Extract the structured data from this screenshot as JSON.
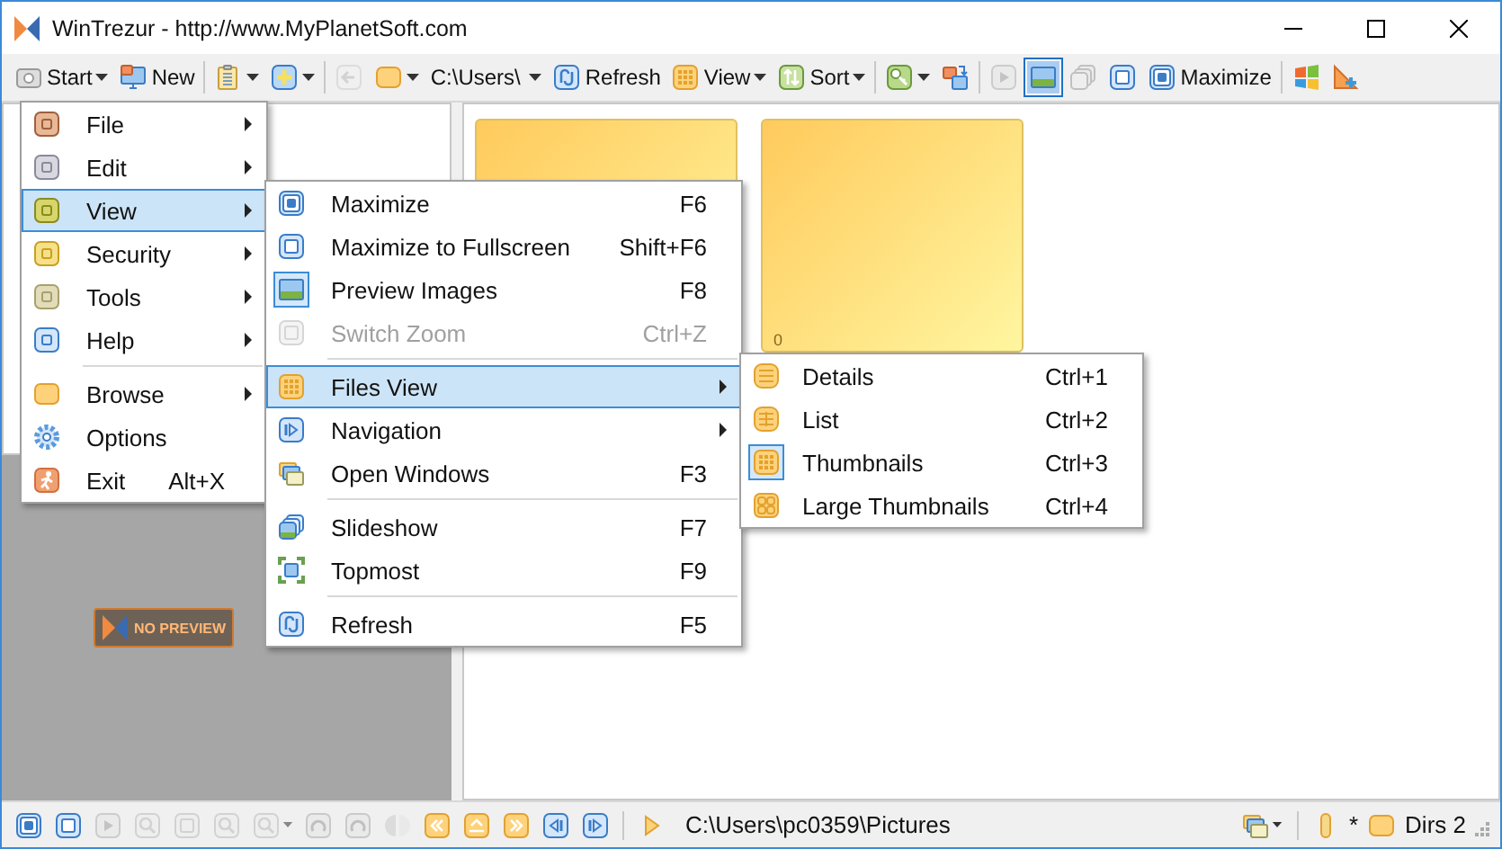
{
  "window": {
    "title": "WinTrezur - http://www.MyPlanetSoft.com"
  },
  "toolbar": [
    {
      "kind": "button",
      "label": "Start",
      "dropdown": true,
      "disabled": false
    },
    {
      "kind": "button",
      "label": "New",
      "dropdown": false,
      "disabled": false
    },
    {
      "kind": "separator"
    },
    {
      "kind": "button",
      "dropdown": true,
      "disabled": false
    },
    {
      "kind": "button",
      "dropdown": true,
      "disabled": false
    },
    {
      "kind": "separator"
    },
    {
      "kind": "button",
      "dropdown": false,
      "disabled": true
    },
    {
      "kind": "button",
      "dropdown": true,
      "disabled": false
    },
    {
      "kind": "path",
      "label": "C:\\Users\\",
      "dropdown": true
    },
    {
      "kind": "button",
      "label": "Refresh",
      "dropdown": false,
      "disabled": false
    },
    {
      "kind": "button",
      "label": "View",
      "dropdown": true,
      "disabled": false
    },
    {
      "kind": "button",
      "label": "Sort",
      "dropdown": true,
      "disabled": false
    },
    {
      "kind": "separator"
    },
    {
      "kind": "button",
      "dropdown": true,
      "disabled": false
    },
    {
      "kind": "button",
      "dropdown": false,
      "disabled": false
    },
    {
      "kind": "separator"
    },
    {
      "kind": "button",
      "dropdown": false,
      "disabled": true,
      "checked": false
    },
    {
      "kind": "button",
      "dropdown": false,
      "disabled": false,
      "checked": true
    },
    {
      "kind": "button",
      "dropdown": false,
      "disabled": true,
      "checked": false
    },
    {
      "kind": "button",
      "dropdown": false,
      "disabled": false
    },
    {
      "kind": "button",
      "label": "Maximize",
      "dropdown": false,
      "disabled": false
    },
    {
      "kind": "separator"
    },
    {
      "kind": "button",
      "dropdown": false,
      "disabled": false
    },
    {
      "kind": "button",
      "dropdown": false,
      "disabled": false
    }
  ],
  "preview": {
    "placeholder_text": "NO PREVIEW"
  },
  "thumbnails": [
    {
      "kind": "folder"
    },
    {
      "kind": "folder",
      "label": "0"
    }
  ],
  "menu": {
    "items": [
      {
        "label": "File",
        "selected": false,
        "submenu": true,
        "separator_above": false
      },
      {
        "label": "Edit",
        "selected": false,
        "submenu": true,
        "separator_above": false
      },
      {
        "label": "View",
        "selected": true,
        "submenu": true,
        "separator_above": false
      },
      {
        "label": "Security",
        "selected": false,
        "submenu": true,
        "separator_above": false
      },
      {
        "label": "Tools",
        "selected": false,
        "submenu": true,
        "separator_above": false
      },
      {
        "label": "Help",
        "selected": false,
        "submenu": true,
        "separator_above": false
      },
      {
        "label": "Browse",
        "selected": false,
        "submenu": true,
        "separator_above": true
      },
      {
        "label": "Options",
        "selected": false,
        "submenu": false,
        "separator_above": false
      },
      {
        "label": "Exit",
        "shortcut": "Alt+X",
        "selected": false,
        "submenu": false,
        "separator_above": false
      }
    ]
  },
  "view_submenu": {
    "items": [
      {
        "label": "Maximize",
        "shortcut": "F6",
        "selected": false,
        "disabled": false,
        "checked": false,
        "submenu": false,
        "separator_above": false
      },
      {
        "label": "Maximize to Fullscreen",
        "shortcut": "Shift+F6",
        "selected": false,
        "disabled": false,
        "checked": false,
        "submenu": false,
        "separator_above": false
      },
      {
        "label": "Preview Images",
        "shortcut": "F8",
        "selected": false,
        "disabled": false,
        "checked": true,
        "submenu": false,
        "separator_above": false
      },
      {
        "label": "Switch Zoom",
        "shortcut": "Ctrl+Z",
        "selected": false,
        "disabled": true,
        "checked": false,
        "submenu": false,
        "separator_above": false
      },
      {
        "label": "Files View",
        "selected": true,
        "disabled": false,
        "checked": false,
        "submenu": true,
        "separator_above": true
      },
      {
        "label": "Navigation",
        "selected": false,
        "disabled": false,
        "checked": false,
        "submenu": true,
        "separator_above": false
      },
      {
        "label": "Open Windows",
        "shortcut": "F3",
        "selected": false,
        "disabled": false,
        "checked": false,
        "submenu": false,
        "separator_above": false
      },
      {
        "label": "Slideshow",
        "shortcut": "F7",
        "selected": false,
        "disabled": false,
        "checked": false,
        "submenu": false,
        "separator_above": true
      },
      {
        "label": "Topmost",
        "shortcut": "F9",
        "selected": false,
        "disabled": false,
        "checked": false,
        "submenu": false,
        "separator_above": false
      },
      {
        "label": "Refresh",
        "shortcut": "F5",
        "selected": false,
        "disabled": false,
        "checked": false,
        "submenu": false,
        "separator_above": true
      }
    ]
  },
  "files_view_submenu": {
    "items": [
      {
        "label": "Details",
        "shortcut": "Ctrl+1",
        "selected": false,
        "checked": false
      },
      {
        "label": "List",
        "shortcut": "Ctrl+2",
        "selected": false,
        "checked": false
      },
      {
        "label": "Thumbnails",
        "shortcut": "Ctrl+3",
        "selected": false,
        "checked": true
      },
      {
        "label": "Large Thumbnails",
        "shortcut": "Ctrl+4",
        "selected": false,
        "checked": false
      }
    ]
  },
  "status_bar": {
    "left_buttons": [
      {
        "kind": "button",
        "disabled": false,
        "dropdown": false
      },
      {
        "kind": "button",
        "disabled": false,
        "dropdown": false
      },
      {
        "kind": "button",
        "disabled": true,
        "dropdown": false
      },
      {
        "kind": "button",
        "disabled": true,
        "dropdown": false
      },
      {
        "kind": "button",
        "disabled": true,
        "dropdown": false
      },
      {
        "kind": "button",
        "disabled": true,
        "dropdown": false
      },
      {
        "kind": "button",
        "disabled": true,
        "dropdown": true
      },
      {
        "kind": "button",
        "disabled": true,
        "dropdown": false
      },
      {
        "kind": "button",
        "disabled": true,
        "dropdown": false
      },
      {
        "kind": "button",
        "disabled": true,
        "dropdown": false
      },
      {
        "kind": "button",
        "disabled": false,
        "dropdown": false
      },
      {
        "kind": "button",
        "disabled": false,
        "dropdown": false
      },
      {
        "kind": "button",
        "disabled": false,
        "dropdown": false
      },
      {
        "kind": "button",
        "disabled": false,
        "dropdown": false
      },
      {
        "kind": "button",
        "disabled": false,
        "dropdown": false
      },
      {
        "kind": "separator"
      },
      {
        "kind": "button",
        "disabled": false,
        "dropdown": false
      }
    ],
    "path": "C:\\Users\\pc0359\\Pictures",
    "right_buttons": [
      {
        "kind": "button",
        "disabled": false,
        "dropdown": true
      }
    ],
    "filter": "*",
    "dirs": "Dirs 2"
  }
}
